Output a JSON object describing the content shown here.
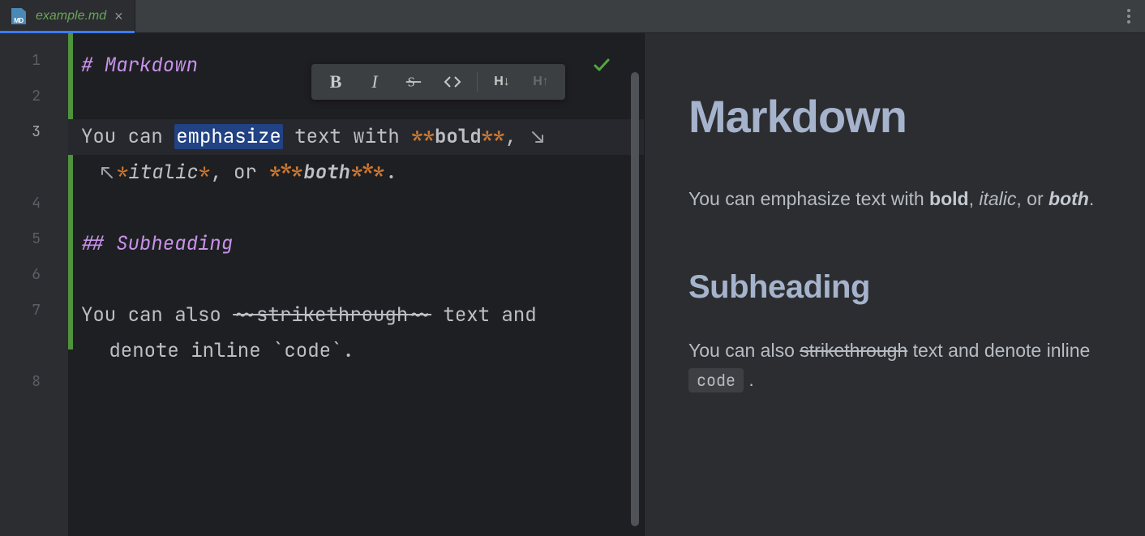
{
  "tab": {
    "filename": "example.md",
    "icon_badge": "MD"
  },
  "editor": {
    "lines": [
      "1",
      "2",
      "3",
      "4",
      "5",
      "6",
      "7",
      "8"
    ],
    "heading1_hash": "# ",
    "heading1_text": "Markdown",
    "heading2_hash": "## ",
    "heading2_text": "Subheading",
    "l3_a": "You can ",
    "l3_sel": "emphasize",
    "l3_b": " text with ",
    "l3_bold_open": "**",
    "l3_bold_text": "bold",
    "l3_bold_close": "**",
    "l3_c": ", ",
    "l3w_it_open": "*",
    "l3w_it_text": "italic",
    "l3w_it_close": "*",
    "l3w_d": ", or ",
    "l3w_both_open": "***",
    "l3w_both_text": "both",
    "l3w_both_close": "***",
    "l3w_e": ".",
    "l7_a": "You can also ",
    "l7_st_open": "~~",
    "l7_st_text": "strikethrough",
    "l7_st_close": "~~",
    "l7_b": " text and",
    "l7w_a": " denote inline ",
    "l7w_tick": "`",
    "l7w_code": "code",
    "l7w_b": "."
  },
  "toolbar": {
    "bold": "B",
    "italic": "I",
    "strike_aria": "Strikethrough",
    "code_aria": "Code",
    "h_down": "H↓",
    "h_up": "H↑"
  },
  "preview": {
    "h1": "Markdown",
    "p1_a": "You can emphasize text with ",
    "p1_bold": "bold",
    "p1_b": ", ",
    "p1_italic": "italic",
    "p1_c": ", or ",
    "p1_both": "both",
    "p1_d": ".",
    "h2": "Subheading",
    "p2_a": "You can also ",
    "p2_strike": "strikethrough",
    "p2_b": " text and denote inline ",
    "p2_code": "code",
    "p2_c": " ."
  }
}
